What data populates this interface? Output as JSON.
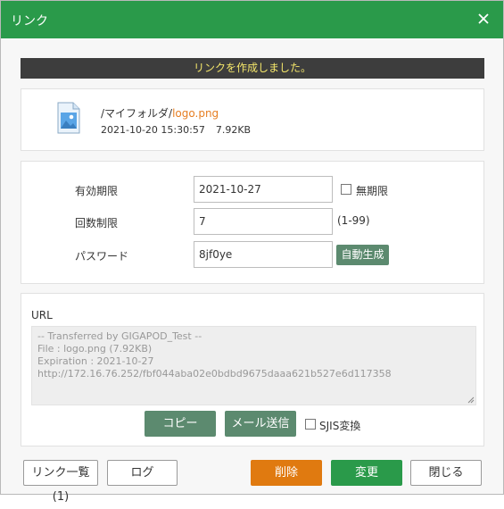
{
  "dialog": {
    "title": "リンク",
    "notice": "リンクを作成しました。"
  },
  "file": {
    "folder": "/マイフォルダ/",
    "name": "logo.png",
    "date": "2021-10-20 15:30:57",
    "size": "7.92KB"
  },
  "form": {
    "expiry_label": "有効期限",
    "expiry_value": "2021-10-27",
    "unlimited_label": "無期限",
    "count_label": "回数制限",
    "count_value": "7",
    "count_range": "(1-99)",
    "password_label": "パスワード",
    "password_value": "8jf0ye",
    "auto_generate": "自動生成"
  },
  "url": {
    "label": "URL",
    "text": "-- Transferred by GIGAPOD_Test --\nFile : logo.png (7.92KB)\nExpiration : 2021-10-27\nhttp://172.16.76.252/fbf044aba02e0bdbd9675daaa621b527e6d117358",
    "copy": "コピー",
    "mail": "メール送信",
    "sjis": "SJIS変換"
  },
  "footer": {
    "link_list": "リンク一覧(1)",
    "log": "ログ",
    "delete": "削除",
    "change": "変更",
    "close": "閉じる"
  },
  "colors": {
    "header": "#2a9a4a",
    "notice_bg": "#3d3d3d",
    "notice_text": "#f4e66a",
    "file_name": "#e67e22",
    "action_button": "#5c8a6f",
    "delete_button": "#e07a10",
    "change_button": "#2a9a4a"
  }
}
